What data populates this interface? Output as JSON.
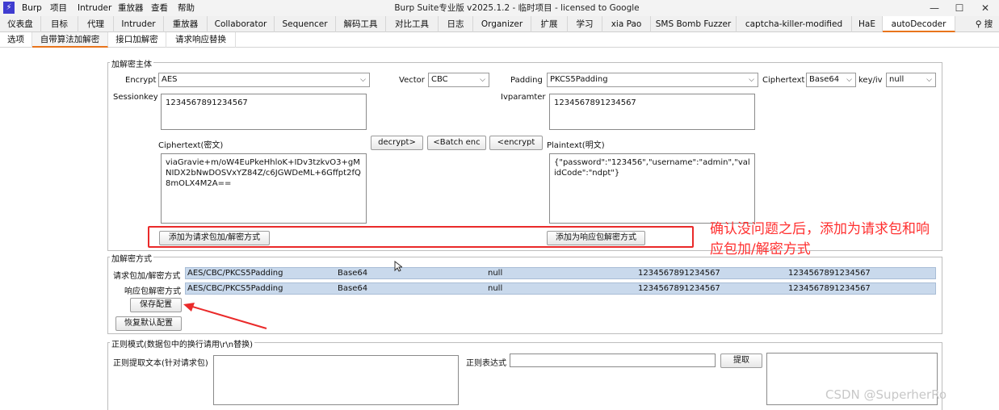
{
  "menubar": {
    "logo": "⚡",
    "items": [
      "Burp",
      "项目",
      "Intruder",
      "重放器",
      "查看",
      "帮助"
    ],
    "title": "Burp Suite专业版  v2025.1.2 - 临时项目 - licensed to Google",
    "controls": [
      "—",
      "☐",
      "✕"
    ]
  },
  "main_tabs": {
    "items": [
      "仪表盘",
      "目标",
      "代理",
      "Intruder",
      "重放器",
      "Collaborator",
      "Sequencer",
      "解码工具",
      "对比工具",
      "日志",
      "Organizer",
      "扩展",
      "学习",
      "xia Pao",
      "SMS Bomb Fuzzer",
      "captcha-killer-modified",
      "HaE",
      "autoDecoder"
    ],
    "search_label": "搜"
  },
  "sub_tabs": {
    "items": [
      "选项",
      "自带算法加解密",
      "接口加解密",
      "请求响应替换"
    ]
  },
  "crypto_group": {
    "title": "加解密主体",
    "encrypt_label": "Encrypt",
    "encrypt_value": "AES",
    "vector_label": "Vector",
    "vector_value": "CBC",
    "padding_label": "Padding",
    "padding_value": "PKCS5Padding",
    "ciphertext_label": "Ciphertext",
    "ciphertext_format": "Base64",
    "keyiv_label": "key/iv",
    "keyiv_value": "null",
    "sessionkey_label": "Sessionkey",
    "sessionkey_value": "1234567891234567",
    "iv_label": "Ivparamter",
    "iv_value": "1234567891234567",
    "cipher_area_label": "Ciphertext(密文)",
    "cipher_area_value": "viaGravie+m/oW4EuPkeHhloK+IDv3tzkvO3+gMNIDX2bNwDOSVxYZ84Z/c6JGWDeML+6Gffpt2fQ8mOLX4M2A==",
    "plain_area_label": "Plaintext(明文)",
    "plain_area_value": "{\"password\":\"123456\",\"username\":\"admin\",\"validCode\":\"ndpt\"}",
    "decrypt_btn": "decrypt>",
    "batch_btn": "<Batch enc",
    "encrypt_btn": "<encrypt",
    "add_req_btn": "添加为请求包加/解密方式",
    "add_resp_btn": "添加为响应包解密方式"
  },
  "method_group": {
    "title": "加解密方式",
    "rows": [
      {
        "label": "请求包加/解密方式",
        "algo": "AES/CBC/PKCS5Padding",
        "format": "Base64",
        "keyiv": "null",
        "key": "1234567891234567",
        "iv": "1234567891234567"
      },
      {
        "label": "响应包解密方式",
        "algo": "AES/CBC/PKCS5Padding",
        "format": "Base64",
        "keyiv": "null",
        "key": "1234567891234567",
        "iv": "1234567891234567"
      }
    ],
    "save_btn": "保存配置",
    "restore_btn": "恢复默认配置"
  },
  "regex_group": {
    "title": "正则模式(数据包中的换行请用\\r\\n替换)",
    "extract_label": "正则提取文本(针对请求包)",
    "expr_label": "正则表达式",
    "extract_btn": "提取"
  },
  "annotation": {
    "line1": "确认没问题之后，添加为请求包和响",
    "line2": "应包加/解密方式"
  },
  "watermark": "CSDN @SuperherRo",
  "colors": {
    "accent": "#e8741c",
    "annotation": "#ea2a2a",
    "row_bg": "#c9d9ec",
    "logo": "#3f3cd0"
  }
}
